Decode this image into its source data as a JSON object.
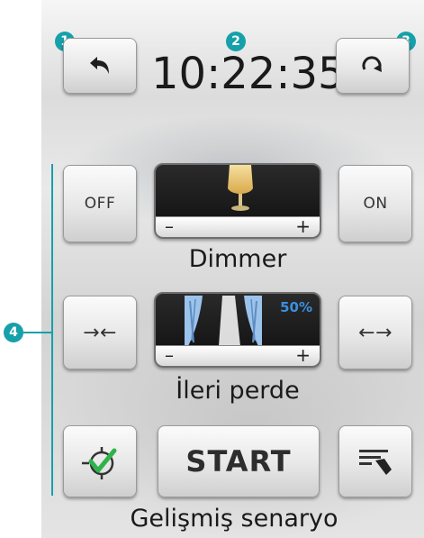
{
  "header": {
    "back_label": "",
    "time": "10:22:35",
    "refresh_label": ""
  },
  "callouts": [
    "1",
    "2",
    "3",
    "4"
  ],
  "dimmer": {
    "off_label": "OFF",
    "on_label": "ON",
    "minus": "–",
    "plus": "+",
    "caption": "Dimmer"
  },
  "curtain": {
    "close_label": "→←",
    "open_label": "←→",
    "percent": "50%",
    "level": 0.5,
    "minus": "–",
    "plus": "+",
    "caption": "İleri perde"
  },
  "scenario": {
    "start_label": "START",
    "caption": "Gelişmiş senaryo"
  },
  "colors": {
    "accent": "#16a0aa",
    "percent_text": "#3b8fe0",
    "check_green": "#2db34a"
  },
  "icons": {
    "back": "back-arrow-icon",
    "refresh": "refresh-icon",
    "lamp": "lamp-icon",
    "curtain": "curtain-icon",
    "scenario_check": "scenario-check-icon",
    "edit": "edit-pen-icon"
  }
}
